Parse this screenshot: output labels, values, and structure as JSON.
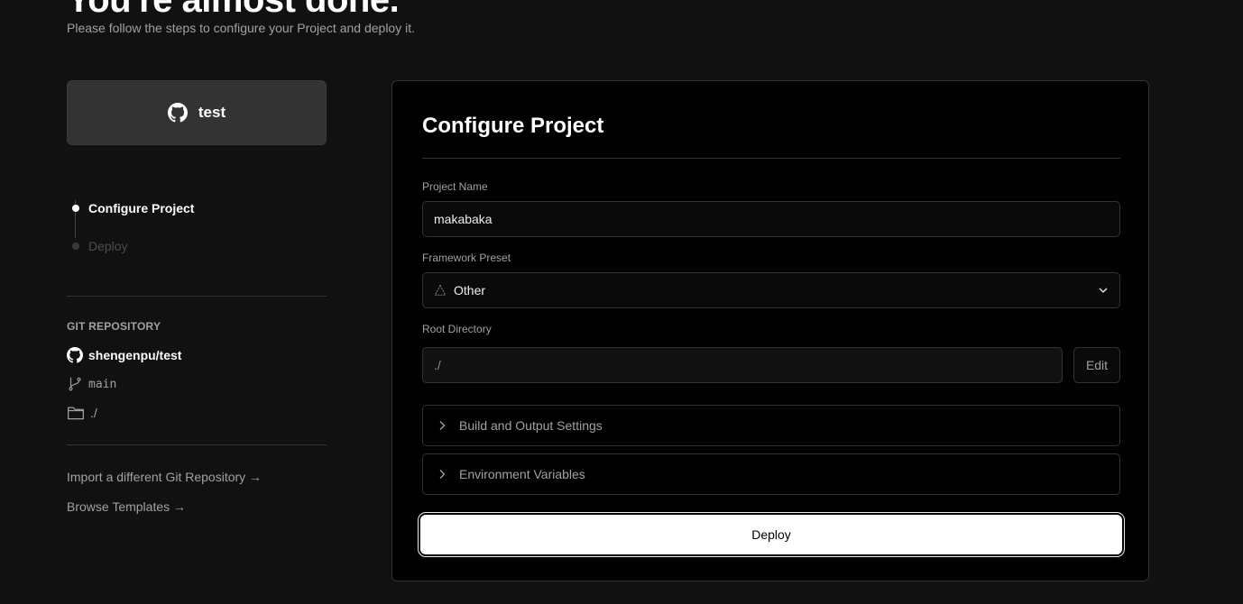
{
  "header": {
    "title": "You're almost done.",
    "subtitle": "Please follow the steps to configure your Project and deploy it."
  },
  "repo_card": {
    "name": "test",
    "icon": "github-icon"
  },
  "steps": [
    {
      "label": "Configure Project",
      "state": "active"
    },
    {
      "label": "Deploy",
      "state": "inactive"
    }
  ],
  "git": {
    "heading": "GIT REPOSITORY",
    "repository": "shengenpu/test",
    "branch": "main",
    "directory": "./"
  },
  "links": {
    "import": "Import a different Git Repository →",
    "templates": "Browse Templates →"
  },
  "configure": {
    "title": "Configure Project",
    "project_name_label": "Project Name",
    "project_name_value": "makabaka",
    "framework_label": "Framework Preset",
    "framework_value": "Other",
    "root_dir_label": "Root Directory",
    "root_dir_value": "./",
    "edit_label": "Edit",
    "build_settings_label": "Build and Output Settings",
    "env_vars_label": "Environment Variables",
    "deploy_label": "Deploy"
  },
  "colors": {
    "background": "#111111",
    "panel": "#000000",
    "border": "#333333",
    "text_primary": "#ffffff",
    "text_secondary": "#a1a1a1",
    "button_primary": "#ffffff"
  }
}
